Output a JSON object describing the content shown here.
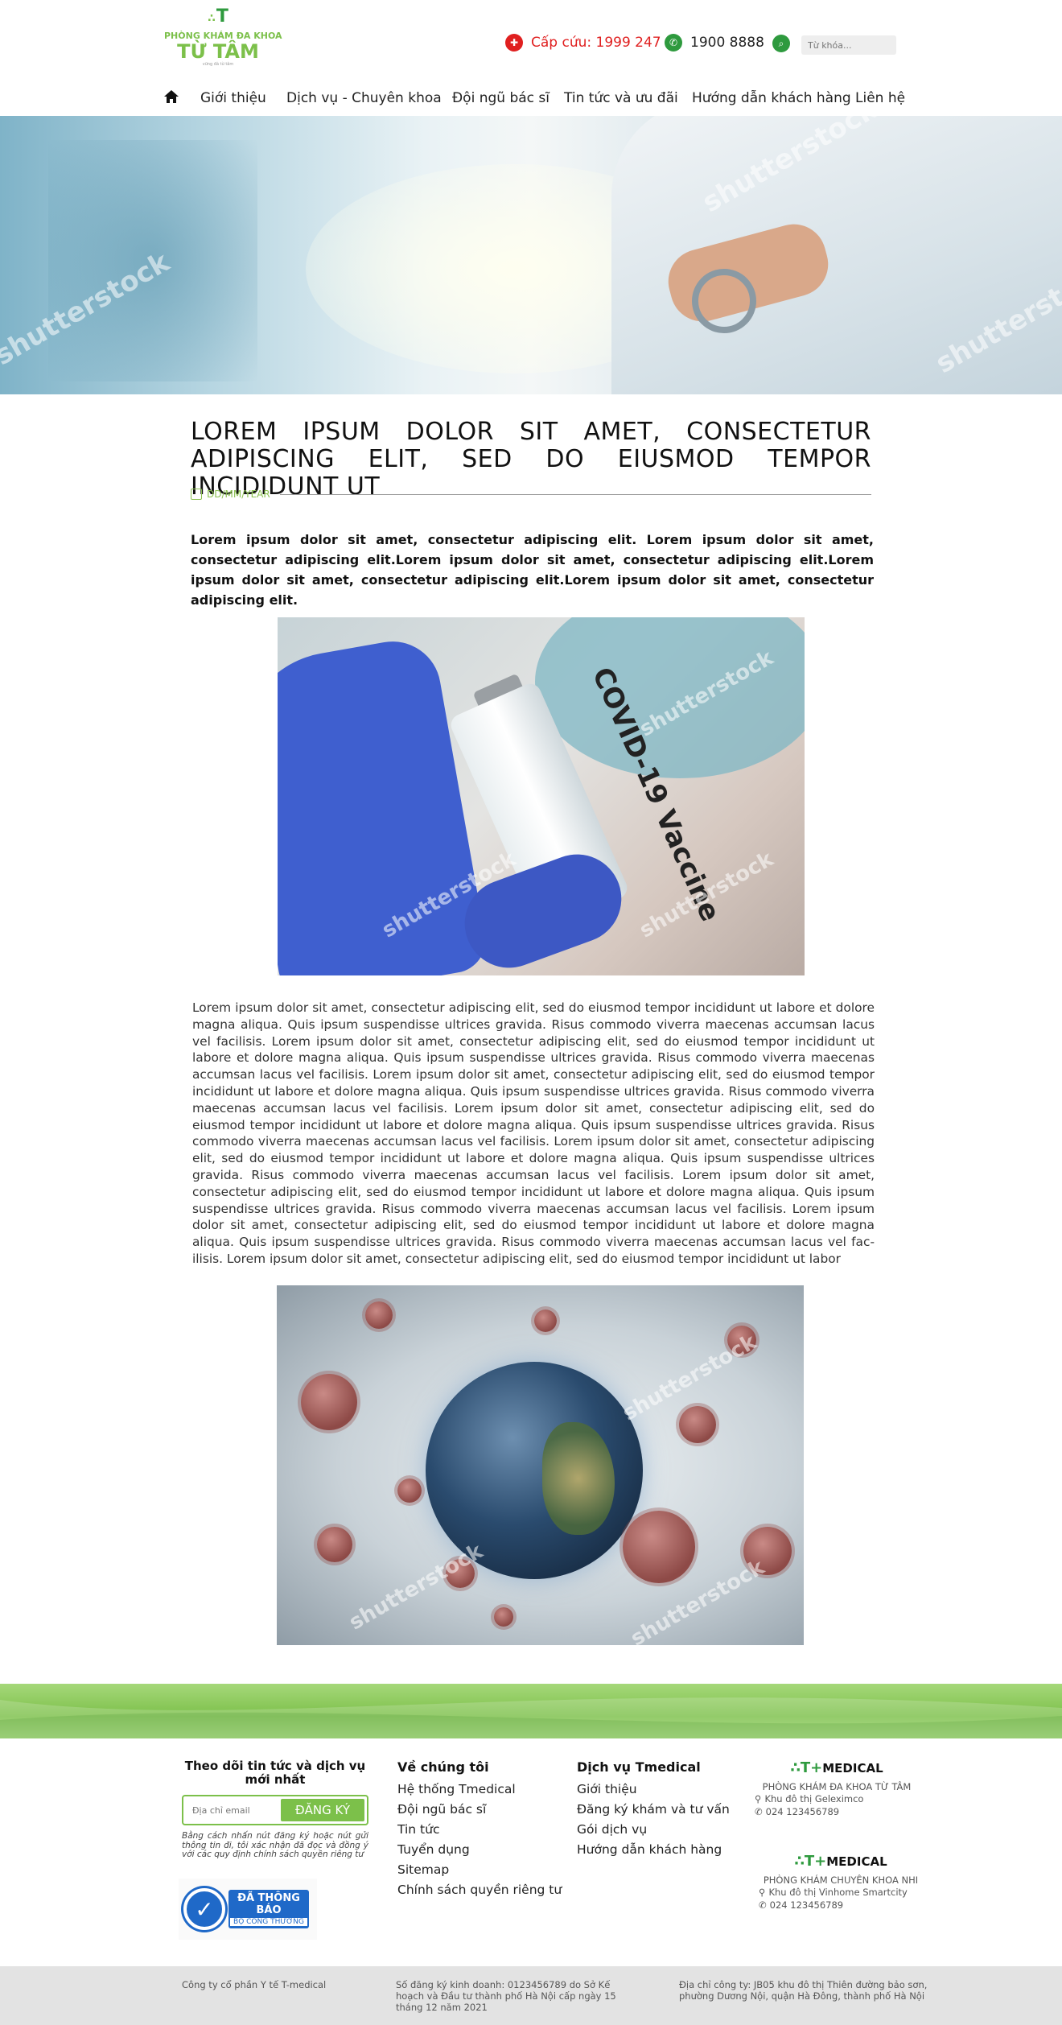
{
  "header": {
    "logo": {
      "brand_line": "PHÒNG KHÁM ĐA KHOA",
      "brand_name": "TỪ TÂM",
      "tagline": "vững đà từ tâm"
    },
    "emergency_label": "Cấp cứu: 1999 247",
    "phone": "1900 8888",
    "search_placeholder": "Từ khóa...",
    "colors": {
      "primary_green": "#7cc04a",
      "dark_green": "#2e9a3e",
      "emergency_red": "#e02020"
    }
  },
  "nav": {
    "items": [
      "Giới thiệu",
      "Dịch vụ - Chuyên khoa",
      "Đội ngũ bác sĩ",
      "Tin tức và ưu đãi",
      "Hướng dẫn khách hàng",
      "Liên hệ"
    ]
  },
  "article": {
    "title": "LOREM IPSUM DOLOR SIT AMET, CONSECTETUR ADIPISC­ING ELIT, SED DO EIUSMOD TEMPOR INCIDIDUNT UT",
    "date": "DD/MM/YEAR",
    "lead": "Lorem ipsum dolor sit amet, consectetur adipiscing elit. Lorem ipsum dolor sit amet, consectetur adipiscing elit.Lorem ipsum dolor sit amet, consectetur adipiscing elit.Lorem ipsum dolor sit amet, consectetur adipiscing elit.Lorem ipsum dolor sit amet, consectetur adipiscing elit.",
    "image1_label": "COVID-19 Vaccine",
    "body": "Lorem ipsum dolor sit amet, consectetur adipiscing elit, sed do eiusmod tempor incididunt ut labore et dolore magna aliqua. Quis ipsum suspendisse ultrices gravida. Risus commodo viverra maecenas accumsan lacus vel fac­ilisis. Lorem ipsum dolor sit amet, consectetur adipiscing elit, sed do eiusmod tempor incididunt ut labore et dolore magna aliqua. Quis ipsum suspendisse ultrices gravida. Risus commodo viverra maecenas accumsan lacus vel fac­ilisis. Lorem ipsum dolor sit amet, consectetur adipiscing elit, sed do eiusmod tempor incididunt ut labore et dolore magna aliqua. Quis ipsum suspendisse ultrices gravida. Risus commodo viverra maecenas accumsan lacus vel fac­ilisis. Lorem ipsum dolor sit amet, consectetur adipiscing elit, sed do eiusmod tempor incididunt ut labore et dolore magna aliqua. Quis ipsum suspendisse ultrices gravida. Risus commodo viverra maecenas accumsan lacus vel fac­ilisis. Lorem ipsum dolor sit amet, consectetur adipiscing elit, sed do eiusmod tempor incididunt ut labore et dolore magna aliqua. Quis ipsum suspendisse ultrices gravida. Risus commodo viverra maecenas accumsan lacus vel fac­ilisis. Lorem ipsum dolor sit amet, consectetur adipiscing elit, sed do eiusmod tempor incididunt ut labore et dolore magna aliqua. Quis ipsum suspendisse ultrices gravida. Risus commodo viverra maecenas accumsan lacus vel fac­ilisis. Lorem ipsum dolor sit amet, consectetur adipiscing elit, sed do eiusmod tempor incididunt ut labore et dolore magna aliqua. Quis ipsum suspendisse ultrices gravida. Risus commodo viverra maecenas accumsan lacus vel fac­ilisis. Lorem ipsum dolor sit amet, consectetur adipiscing elit, sed do eiusmod tempor incididunt ut labor",
    "watermark": "shutterstock"
  },
  "footer": {
    "subscribe": {
      "title": "Theo dõi tin tức và dịch vụ mới nhất",
      "placeholder": "Địa chỉ email",
      "button": "ĐĂNG KÝ",
      "note": "Bằng cách nhấn nút đăng ký hoặc nút gửi thông tin đi, tôi xác nhận đã đọc và đồng ý với các quy định chính sách quyền riêng tư"
    },
    "badge": {
      "line1": "ĐÃ THÔNG BÁO",
      "line2": "BỘ CÔNG THƯƠNG"
    },
    "about": {
      "title": "Về chúng tôi",
      "links": [
        "Hệ thống Tmedical",
        "Đội ngũ bác sĩ",
        "Tin tức",
        "Tuyển dụng",
        "Sitemap",
        "Chính sách quyền riêng tư"
      ]
    },
    "services": {
      "title": "Dịch vụ Tmedical",
      "links": [
        "Giới thiệu",
        "Đăng ký khám và tư vấn",
        "Gói dịch vụ",
        "Hướng dẫn khách hàng"
      ]
    },
    "branches": [
      {
        "logo": "MEDICAL",
        "name": "PHÒNG KHÁM ĐA KHOA TỪ TÂM",
        "address": "Khu đô thị Geleximco",
        "phone": "024 123456789"
      },
      {
        "logo": "MEDICAL",
        "name": "PHÒNG KHÁM CHUYÊN KHOA NHI",
        "address": "Khu đô thị Vinhome Smartcity",
        "phone": "024 123456789"
      }
    ],
    "bottom": {
      "company": "Công ty cổ phần Y tế T-medical",
      "registration": "Số đăng ký kinh doanh: 0123456789 do Sở Kế hoạch và Đầu tư thành phố Hà Nội cấp ngày 15 tháng 12 năm 2021",
      "address": "Địa chỉ công ty: JB05 khu đô thị Thiên đường bảo sơn, phường Dương Nội, quận Hà Đông, thành phố Hà Nội"
    }
  }
}
